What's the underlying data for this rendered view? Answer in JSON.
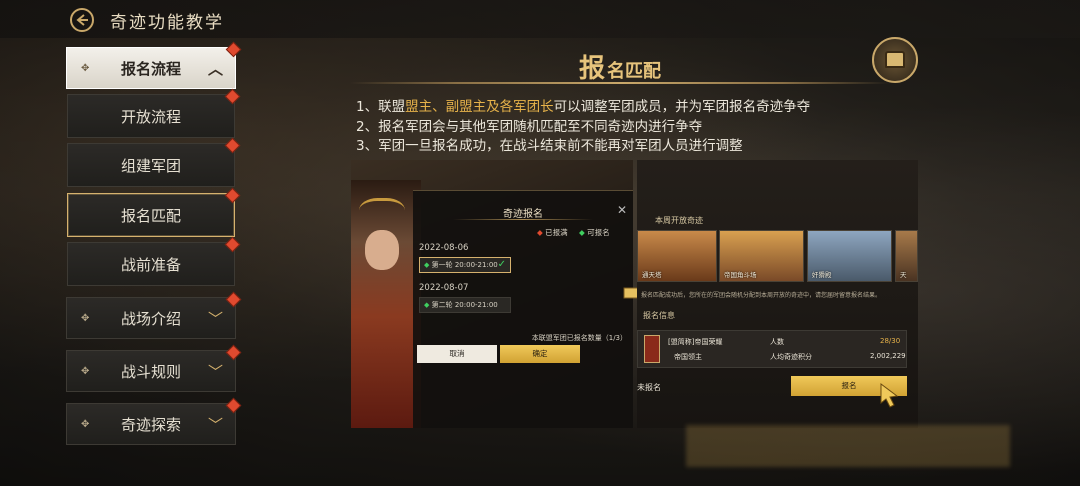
{
  "header": {
    "title": "奇迹功能教学"
  },
  "sidebar": {
    "group1": {
      "label": "报名流程"
    },
    "items": [
      {
        "label": "开放流程"
      },
      {
        "label": "组建军团"
      },
      {
        "label": "报名匹配"
      },
      {
        "label": "战前准备"
      }
    ],
    "group2": {
      "label": "战场介绍"
    },
    "group3": {
      "label": "战斗规则"
    },
    "group4": {
      "label": "奇迹探索"
    }
  },
  "content": {
    "heading_big": "报",
    "heading_small": "名匹配",
    "line1_pre": "1、联盟",
    "line1_hl": "盟主、副盟主及各军团长",
    "line1_post": "可以调整军团成员，并为军团报名奇迹争夺",
    "line2": "2、报名军团会与其他军团随机匹配至不同奇迹内进行争夺",
    "line3": "3、军团一旦报名成功，在战斗结束前不能再对军团人员进行调整"
  },
  "shot1": {
    "title": "奇迹报名",
    "legend_full": "已报满",
    "legend_open": "可报名",
    "date1": "2022-08-06",
    "slot1": "第一轮 20:00-21:00",
    "date2": "2022-08-07",
    "slot2": "第二轮 20:00-21:00",
    "count": "本联盟军团已报名数量（1/3）",
    "cancel": "取消",
    "confirm": "确定"
  },
  "shot2": {
    "open_header": "本周开放奇迹",
    "thumbs": [
      "通天塔",
      "帝国角斗场",
      "奸猾殿",
      "天"
    ],
    "tip": "报名匹配成功后，您所在的军团会随机分配到本周开放的奇迹中，请您届时留意报名结果。",
    "section": "报名信息",
    "guild": "[盟简称]帝国荣耀",
    "leader": "帝国领主",
    "people_label": "人数",
    "people_value": "28/30",
    "score_label": "人均奇迹积分",
    "score_value": "2,002,229",
    "status": "未报名",
    "signup": "报名"
  }
}
